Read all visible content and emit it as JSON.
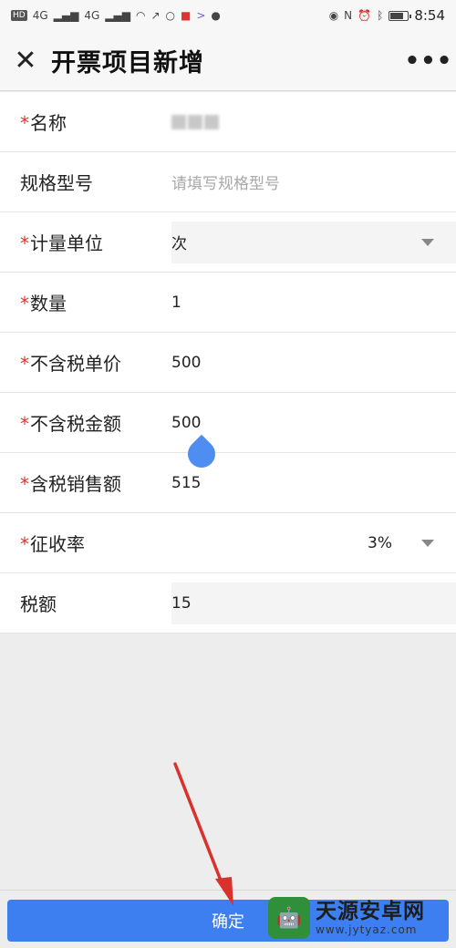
{
  "status_bar": {
    "left_icons": [
      "HD",
      "4G",
      "signal",
      "4G",
      "signal",
      "wifi",
      "missed-call",
      "search",
      "app",
      ">",
      "app"
    ],
    "right_icons": [
      "eye",
      "nfc",
      "alarm",
      "bluetooth",
      "battery"
    ],
    "time": "8:54"
  },
  "header": {
    "close_icon": "✕",
    "title": "开票项目新增",
    "more_icon": "•••"
  },
  "form": {
    "required_mark": "*",
    "name": {
      "label": "名称",
      "value": ""
    },
    "spec": {
      "label": "规格型号",
      "placeholder": "请填写规格型号"
    },
    "unit": {
      "label": "计量单位",
      "value": "次"
    },
    "quantity": {
      "label": "数量",
      "value": "1"
    },
    "price_excl_tax": {
      "label": "不含税单价",
      "value": "500"
    },
    "amount_excl_tax": {
      "label": "不含税金额",
      "value": "500"
    },
    "amount_incl_tax": {
      "label": "含税销售额",
      "value": "515"
    },
    "tax_rate": {
      "label": "征收率",
      "value": "3%"
    },
    "tax_amount": {
      "label": "税额",
      "value": "15"
    }
  },
  "footer": {
    "confirm_label": "确定"
  },
  "watermark": {
    "title": "天源安卓网",
    "url": "www.jytyaz.com"
  },
  "colors": {
    "primary": "#3d7ff0",
    "required": "#d23a2f",
    "annotation_arrow": "#d9312b"
  }
}
